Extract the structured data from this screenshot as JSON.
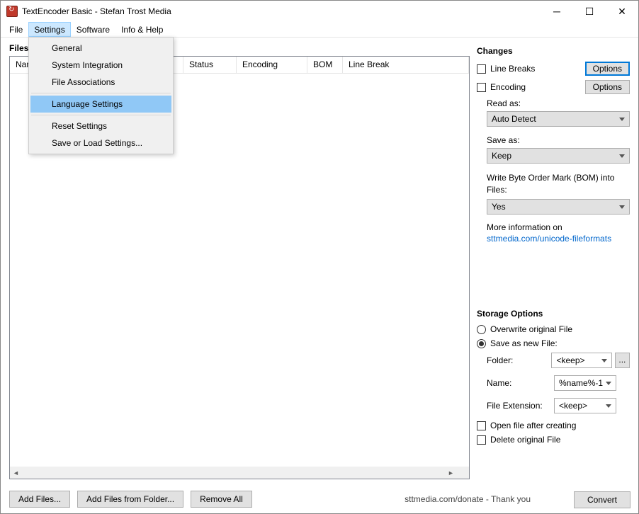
{
  "window": {
    "title": "TextEncoder Basic - Stefan Trost Media"
  },
  "menubar": {
    "items": [
      "File",
      "Settings",
      "Software",
      "Info & Help"
    ],
    "open_index": 1
  },
  "dropdown": {
    "items": [
      {
        "label": "General"
      },
      {
        "label": "System Integration"
      },
      {
        "label": "File Associations"
      },
      {
        "sep": true
      },
      {
        "label": "Language Settings",
        "selected": true
      },
      {
        "sep": true
      },
      {
        "label": "Reset Settings"
      },
      {
        "label": "Save or Load Settings..."
      }
    ]
  },
  "files_section": {
    "heading": "Files",
    "columns": {
      "name": "Name",
      "status": "Status",
      "encoding": "Encoding",
      "bom": "BOM",
      "linebreak": "Line Break"
    }
  },
  "bottom": {
    "add_files": "Add Files...",
    "add_folder": "Add Files from Folder...",
    "remove_all": "Remove All",
    "donate": "sttmedia.com/donate - Thank you",
    "convert": "Convert"
  },
  "changes": {
    "heading": "Changes",
    "line_breaks": "Line Breaks",
    "encoding": "Encoding",
    "options_btn": "Options",
    "read_as": "Read as:",
    "read_as_value": "Auto Detect",
    "save_as": "Save as:",
    "save_as_value": "Keep",
    "bom_label": "Write Byte Order Mark (BOM) into Files:",
    "bom_value": "Yes",
    "more_info": "More information on",
    "more_info_link": "sttmedia.com/unicode-fileformats"
  },
  "storage": {
    "heading": "Storage Options",
    "overwrite": "Overwrite original File",
    "save_new": "Save as new File:",
    "folder_label": "Folder:",
    "folder_value": "<keep>",
    "name_label": "Name:",
    "name_value": "%name%-1",
    "ext_label": "File Extension:",
    "ext_value": "<keep>",
    "open_after": "Open file after creating",
    "delete_orig": "Delete original File"
  }
}
